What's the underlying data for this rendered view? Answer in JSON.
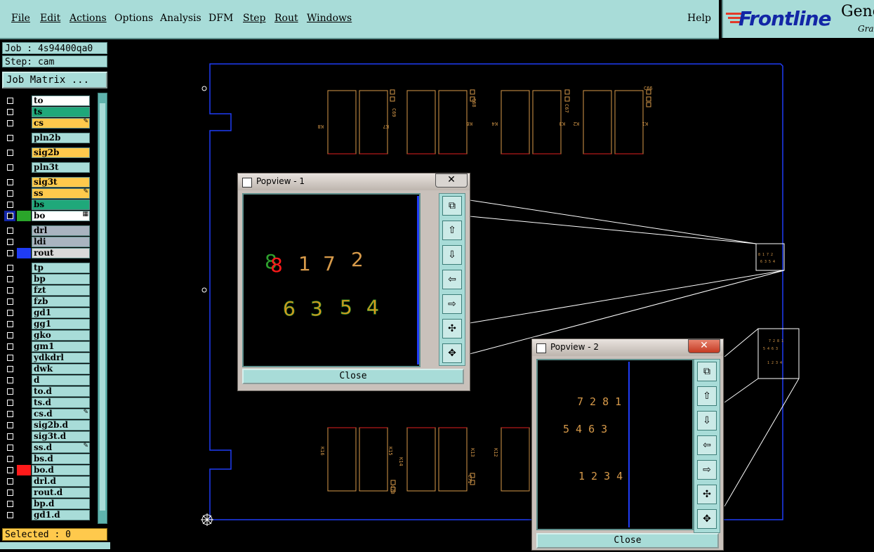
{
  "menubar": {
    "items": [
      "File",
      "Edit",
      "Actions",
      "Options",
      "Analysis",
      "DFM",
      "Step",
      "Rout",
      "Windows"
    ],
    "help": "Help"
  },
  "logo": {
    "brand": "Frontline",
    "partial1": "Gene",
    "partial2": "Grap"
  },
  "job": {
    "label": "Job : 4s94400qa0",
    "step": "Step: cam",
    "matrix_button": "Job Matrix ..."
  },
  "layers": [
    {
      "name": "to",
      "bg": "#ffffff",
      "chk": false
    },
    {
      "name": "ts",
      "bg": "#1fa87a",
      "chk": false
    },
    {
      "name": "cs",
      "bg": "#ffc94c",
      "chk": false,
      "mark": "✎"
    },
    {
      "name": "pln2b",
      "bg": "#a8dcd8",
      "chk": false
    },
    {
      "name": "sig2b",
      "bg": "#ffc94c",
      "chk": false
    },
    {
      "name": "pln3t",
      "bg": "#a8dcd8",
      "chk": false
    },
    {
      "name": "sig3t",
      "bg": "#ffc94c",
      "chk": false
    },
    {
      "name": "ss",
      "bg": "#ffc94c",
      "chk": false,
      "mark": "✎"
    },
    {
      "name": "bs",
      "bg": "#1fa87a",
      "chk": false
    },
    {
      "name": "bo",
      "bg": "#ffffff",
      "chk": true,
      "col": "#2aa52a",
      "mark": "▦"
    },
    {
      "name": "drl",
      "bg": "#a9b4c0",
      "chk": false
    },
    {
      "name": "ldi",
      "bg": "#a9b4c0",
      "chk": false
    },
    {
      "name": "rout",
      "bg": "#d9d9d9",
      "chk": false,
      "col": "#1f3cf5"
    },
    {
      "name": "tp",
      "bg": "#a8dcd8",
      "chk": false
    },
    {
      "name": "bp",
      "bg": "#a8dcd8",
      "chk": false
    },
    {
      "name": "fzt",
      "bg": "#a8dcd8",
      "chk": false
    },
    {
      "name": "fzb",
      "bg": "#a8dcd8",
      "chk": false
    },
    {
      "name": "gd1",
      "bg": "#a8dcd8",
      "chk": false
    },
    {
      "name": "gg1",
      "bg": "#a8dcd8",
      "chk": false
    },
    {
      "name": "gko",
      "bg": "#a8dcd8",
      "chk": false
    },
    {
      "name": "gm1",
      "bg": "#a8dcd8",
      "chk": false
    },
    {
      "name": "ydkdrl",
      "bg": "#a8dcd8",
      "chk": false
    },
    {
      "name": "dwk",
      "bg": "#a8dcd8",
      "chk": false
    },
    {
      "name": "d",
      "bg": "#a8dcd8",
      "chk": false
    },
    {
      "name": "to.d",
      "bg": "#a8dcd8",
      "chk": false
    },
    {
      "name": "ts.d",
      "bg": "#a8dcd8",
      "chk": false
    },
    {
      "name": "cs.d",
      "bg": "#a8dcd8",
      "chk": false,
      "mark": "✎"
    },
    {
      "name": "sig2b.d",
      "bg": "#a8dcd8",
      "chk": false
    },
    {
      "name": "sig3t.d",
      "bg": "#a8dcd8",
      "chk": false
    },
    {
      "name": "ss.d",
      "bg": "#a8dcd8",
      "chk": false,
      "mark": "✎"
    },
    {
      "name": "bs.d",
      "bg": "#a8dcd8",
      "chk": false
    },
    {
      "name": "bo.d",
      "bg": "#a8dcd8",
      "chk": false,
      "col": "#ff1a1a"
    },
    {
      "name": "drl.d",
      "bg": "#a8dcd8",
      "chk": false
    },
    {
      "name": "rout.d",
      "bg": "#a8dcd8",
      "chk": false
    },
    {
      "name": "bp.d",
      "bg": "#a8dcd8",
      "chk": false
    },
    {
      "name": "gd1.d",
      "bg": "#a8dcd8",
      "chk": false
    }
  ],
  "status": {
    "selected": "Selected : 0"
  },
  "canvas": {
    "top_labels": [
      "K8",
      "K7",
      "C69",
      "K6",
      "C68",
      "K4",
      "K3",
      "C67",
      "K2",
      "K1",
      "C66"
    ],
    "bottom_labels": [
      "K16",
      "K15",
      "K14",
      "K13",
      "K12",
      "C71",
      "C70"
    ]
  },
  "popview1": {
    "title": "Popview - 1",
    "close_label": "Close",
    "row1": [
      "8",
      "8",
      "1",
      "7",
      "2"
    ],
    "row2": [
      "6",
      "3",
      "5",
      "4"
    ]
  },
  "popview2": {
    "title": "Popview - 2",
    "close_label": "Close",
    "row1": "7 2 8 1",
    "row2": "5   4 6 3",
    "row3": "1 2 3 4"
  },
  "colors": {
    "panel": "#a8dcd8",
    "orange": "#ffc94c",
    "outline": "#1f3cf5",
    "pad": "#d79a4a"
  }
}
